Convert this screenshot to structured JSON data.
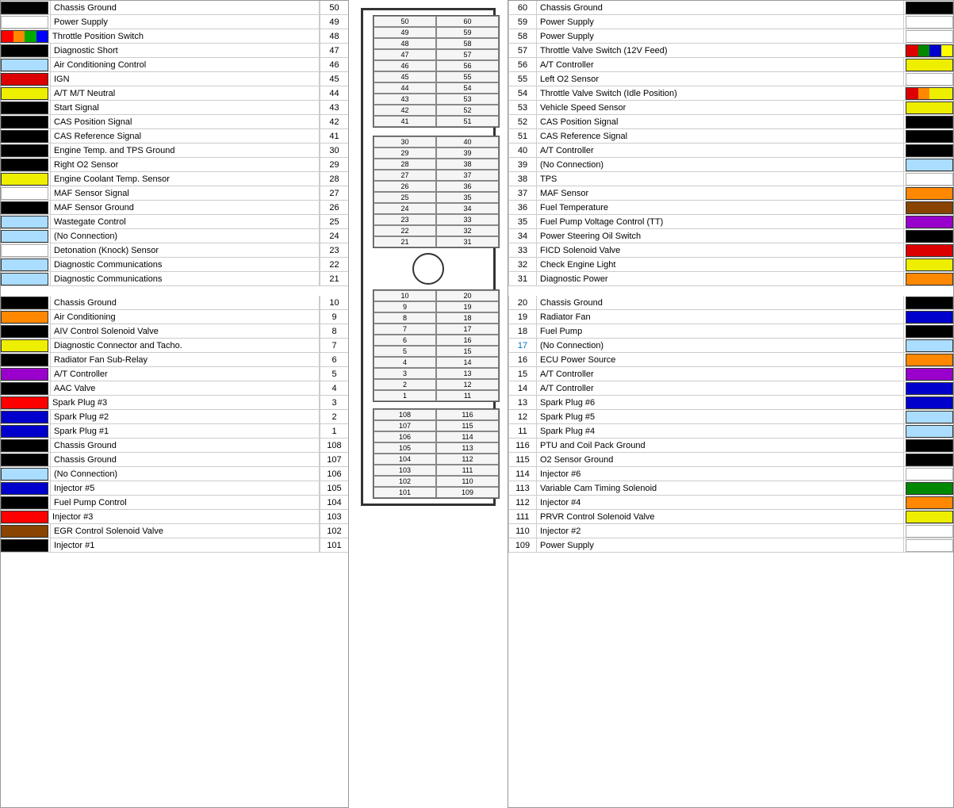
{
  "left": {
    "pins": [
      {
        "num": "50",
        "label": "Chassis Ground",
        "color": "#000000",
        "type": "solid"
      },
      {
        "num": "49",
        "label": "Power Supply",
        "color": "#ffffff",
        "type": "solid"
      },
      {
        "num": "48",
        "label": "Throttle Position Switch",
        "color": "multi1",
        "type": "multi",
        "colors": [
          "#ff0000",
          "#ff8800",
          "#00aa00",
          "#0000ff"
        ]
      },
      {
        "num": "47",
        "label": "Diagnostic Short",
        "color": "#000000",
        "type": "solid"
      },
      {
        "num": "46",
        "label": "Air Conditioning Control",
        "color": "#aaddff",
        "type": "solid"
      },
      {
        "num": "45",
        "label": "IGN",
        "color": "#dd0000",
        "type": "solid"
      },
      {
        "num": "44",
        "label": "A/T M/T Neutral",
        "color": "#eeee00",
        "type": "solid"
      },
      {
        "num": "43",
        "label": "Start Signal",
        "color": "#000000",
        "type": "solid"
      },
      {
        "num": "42",
        "label": "CAS Position Signal",
        "color": "#000000",
        "type": "solid"
      },
      {
        "num": "41",
        "label": "CAS Reference Signal",
        "color": "#000000",
        "type": "solid"
      },
      {
        "num": "30",
        "label": "Engine Temp. and TPS Ground",
        "color": "#000000",
        "type": "solid"
      },
      {
        "num": "29",
        "label": "Right O2 Sensor",
        "color": "#000000",
        "type": "solid"
      },
      {
        "num": "28",
        "label": "Engine Coolant Temp. Sensor",
        "color": "#eeee00",
        "type": "solid"
      },
      {
        "num": "27",
        "label": "MAF Sensor Signal",
        "color": "#ffffff",
        "type": "solid"
      },
      {
        "num": "26",
        "label": "MAF Sensor Ground",
        "color": "#000000",
        "type": "solid"
      },
      {
        "num": "25",
        "label": "Wastegate Control",
        "color": "#aaddff",
        "type": "solid"
      },
      {
        "num": "24",
        "label": "(No Connection)",
        "color": "#aaddff",
        "type": "solid"
      },
      {
        "num": "23",
        "label": "Detonation (Knock) Sensor",
        "color": "#ffffff",
        "type": "solid"
      },
      {
        "num": "22",
        "label": "Diagnostic Communications",
        "color": "#aaddff",
        "type": "solid"
      },
      {
        "num": "21",
        "label": "Diagnostic Communications",
        "color": "#aaddff",
        "type": "solid"
      },
      {
        "num": "GAP",
        "label": "",
        "color": "",
        "type": "gap"
      },
      {
        "num": "10",
        "label": "Chassis Ground",
        "color": "#000000",
        "type": "solid"
      },
      {
        "num": "9",
        "label": "Air Conditioning",
        "color": "#ff8800",
        "type": "solid"
      },
      {
        "num": "8",
        "label": "AIV Control Solenoid Valve",
        "color": "#000000",
        "type": "solid"
      },
      {
        "num": "7",
        "label": "Diagnostic Connector and Tacho.",
        "color": "#eeee00",
        "type": "solid"
      },
      {
        "num": "6",
        "label": "Radiator Fan Sub-Relay",
        "color": "#000000",
        "type": "solid"
      },
      {
        "num": "5",
        "label": "A/T Controller",
        "color": "#9900cc",
        "type": "solid"
      },
      {
        "num": "4",
        "label": "AAC Valve",
        "color": "#000000",
        "type": "solid"
      },
      {
        "num": "3",
        "label": "Spark Plug #3",
        "color": "multi2",
        "type": "multi",
        "colors": [
          "#ff0000",
          "#ff0000",
          "#ff0000",
          "#ff0000"
        ]
      },
      {
        "num": "2",
        "label": "Spark Plug #2",
        "color": "#0000cc",
        "type": "solid"
      },
      {
        "num": "1",
        "label": "Spark Plug #1",
        "color": "#0000cc",
        "type": "solid"
      },
      {
        "num": "108",
        "label": "Chassis Ground",
        "color": "#000000",
        "type": "solid"
      },
      {
        "num": "107",
        "label": "Chassis Ground",
        "color": "#000000",
        "type": "solid"
      },
      {
        "num": "106",
        "label": "(No Connection)",
        "color": "#aaddff",
        "type": "solid"
      },
      {
        "num": "105",
        "label": "Injector #5",
        "color": "#0000cc",
        "type": "solid"
      },
      {
        "num": "104",
        "label": "Fuel Pump Control",
        "color": "#000000",
        "type": "solid"
      },
      {
        "num": "103",
        "label": "Injector #3",
        "color": "multi3",
        "type": "multi",
        "colors": [
          "#ff0000",
          "#ff0000",
          "#ff0000",
          "#ff0000"
        ]
      },
      {
        "num": "102",
        "label": "EGR Control Solenoid Valve",
        "color": "#884400",
        "type": "solid"
      },
      {
        "num": "101",
        "label": "Injector #1",
        "color": "#000000",
        "type": "solid"
      }
    ]
  },
  "right": {
    "pins": [
      {
        "num": "60",
        "label": "Chassis Ground",
        "color": "#000000",
        "type": "solid"
      },
      {
        "num": "59",
        "label": "Power Supply",
        "color": "#ffffff",
        "type": "solid"
      },
      {
        "num": "58",
        "label": "Power Supply",
        "color": "#ffffff",
        "type": "solid"
      },
      {
        "num": "57",
        "label": "Throttle Valve Switch (12V Feed)",
        "color": "multi4",
        "type": "multi",
        "colors": [
          "#dd0000",
          "#008800",
          "#0000cc",
          "#ffff00"
        ]
      },
      {
        "num": "56",
        "label": "A/T Controller",
        "color": "#eeee00",
        "type": "solid"
      },
      {
        "num": "55",
        "label": "Left O2 Sensor",
        "color": "#ffffff",
        "type": "solid"
      },
      {
        "num": "54",
        "label": "Throttle Valve Switch (Idle Position)",
        "color": "multi5",
        "type": "multi",
        "colors": [
          "#dd0000",
          "#ff8800",
          "#eeee00",
          "#eeee00"
        ]
      },
      {
        "num": "53",
        "label": "Vehicle Speed Sensor",
        "color": "#eeee00",
        "type": "solid"
      },
      {
        "num": "52",
        "label": "CAS Position Signal",
        "color": "#000000",
        "type": "solid"
      },
      {
        "num": "51",
        "label": "CAS Reference Signal",
        "color": "#000000",
        "type": "solid"
      },
      {
        "num": "40",
        "label": "A/T Controller",
        "color": "#000000",
        "type": "solid"
      },
      {
        "num": "39",
        "label": "(No Connection)",
        "color": "#aaddff",
        "type": "solid"
      },
      {
        "num": "38",
        "label": "TPS",
        "color": "#ffffff",
        "type": "solid"
      },
      {
        "num": "37",
        "label": "MAF Sensor",
        "color": "#ff8800",
        "type": "solid"
      },
      {
        "num": "36",
        "label": "Fuel Temperature",
        "color": "#884400",
        "type": "solid"
      },
      {
        "num": "35",
        "label": "Fuel Pump Voltage Control (TT)",
        "color": "#9900cc",
        "type": "solid"
      },
      {
        "num": "34",
        "label": "Power Steering Oil Switch",
        "color": "#000000",
        "type": "solid"
      },
      {
        "num": "33",
        "label": "FICD Solenoid Valve",
        "color": "#dd0000",
        "type": "solid"
      },
      {
        "num": "32",
        "label": "Check Engine Light",
        "color": "#eeee00",
        "type": "solid"
      },
      {
        "num": "31",
        "label": "Diagnostic Power",
        "color": "#ff8800",
        "type": "solid"
      },
      {
        "num": "GAP",
        "label": "",
        "color": "",
        "type": "gap"
      },
      {
        "num": "20",
        "label": "Chassis Ground",
        "color": "#000000",
        "type": "solid"
      },
      {
        "num": "19",
        "label": "Radiator Fan",
        "color": "#0000cc",
        "type": "solid"
      },
      {
        "num": "18",
        "label": "Fuel Pump",
        "color": "#000000",
        "type": "solid"
      },
      {
        "num": "17",
        "label": "(No Connection)",
        "color": "#aaddff",
        "type": "solid",
        "numcolor": "#0070c0"
      },
      {
        "num": "16",
        "label": "ECU Power Source",
        "color": "#ff8800",
        "type": "solid"
      },
      {
        "num": "15",
        "label": "A/T Controller",
        "color": "#9900cc",
        "type": "solid"
      },
      {
        "num": "14",
        "label": "A/T Controller",
        "color": "#0000cc",
        "type": "solid"
      },
      {
        "num": "13",
        "label": "Spark Plug #6",
        "color": "#0000cc",
        "type": "solid"
      },
      {
        "num": "12",
        "label": "Spark Plug #5",
        "color": "#aaddff",
        "type": "solid"
      },
      {
        "num": "11",
        "label": "Spark Plug #4",
        "color": "#aaddff",
        "type": "solid"
      },
      {
        "num": "116",
        "label": "PTU and Coil Pack Ground",
        "color": "#000000",
        "type": "solid"
      },
      {
        "num": "115",
        "label": "O2 Sensor Ground",
        "color": "#000000",
        "type": "solid"
      },
      {
        "num": "114",
        "label": "Injector #6",
        "color": "#ffffff",
        "type": "solid"
      },
      {
        "num": "113",
        "label": "Variable Cam Timing Solenoid",
        "color": "#008800",
        "type": "solid"
      },
      {
        "num": "112",
        "label": "Injector #4",
        "color": "#ff8800",
        "type": "solid"
      },
      {
        "num": "111",
        "label": "PRVR Control Solenoid Valve",
        "color": "#eeee00",
        "type": "solid"
      },
      {
        "num": "110",
        "label": "Injector #2",
        "color": "#ffffff",
        "type": "solid"
      },
      {
        "num": "109",
        "label": "Power Supply",
        "color": "#ffffff",
        "type": "solid"
      }
    ]
  },
  "center": {
    "top_pins": [
      [
        50,
        60
      ],
      [
        49,
        59
      ],
      [
        48,
        58
      ],
      [
        47,
        57
      ],
      [
        46,
        56
      ],
      [
        45,
        55
      ],
      [
        44,
        54
      ],
      [
        43,
        53
      ],
      [
        42,
        52
      ],
      [
        41,
        51
      ]
    ],
    "mid_pins": [
      [
        30,
        40
      ],
      [
        29,
        39
      ],
      [
        28,
        38
      ],
      [
        27,
        37
      ],
      [
        26,
        36
      ],
      [
        25,
        35
      ],
      [
        24,
        34
      ],
      [
        23,
        33
      ],
      [
        22,
        32
      ],
      [
        21,
        31
      ]
    ],
    "bot_pins": [
      [
        10,
        20
      ],
      [
        9,
        19
      ],
      [
        8,
        18
      ],
      [
        7,
        17
      ],
      [
        6,
        16
      ],
      [
        5,
        15
      ],
      [
        4,
        14
      ],
      [
        3,
        13
      ],
      [
        2,
        12
      ],
      [
        1,
        11
      ]
    ],
    "extra_pins": [
      [
        108,
        116
      ],
      [
        107,
        115
      ],
      [
        106,
        114
      ],
      [
        105,
        113
      ],
      [
        104,
        112
      ],
      [
        103,
        111
      ],
      [
        102,
        110
      ],
      [
        101,
        109
      ]
    ]
  }
}
